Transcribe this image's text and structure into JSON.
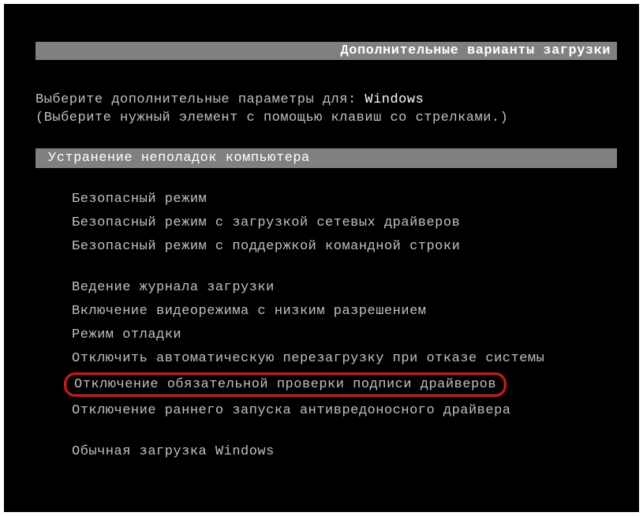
{
  "title": "Дополнительные варианты загрузки",
  "instruction_prefix": "Выберите дополнительные параметры для: ",
  "os_name": "Windows",
  "instruction_hint": "(Выберите нужный элемент с помощью клавиш со стрелками.)",
  "menu": {
    "repair": "Устранение неполадок компьютера",
    "safe_mode": "Безопасный режим",
    "safe_mode_net": "Безопасный режим с загрузкой сетевых драйверов",
    "safe_mode_cmd": "Безопасный режим с поддержкой командной строки",
    "boot_logging": "Ведение журнала загрузки",
    "low_res": "Включение видеорежима с низким разрешением",
    "debug": "Режим отладки",
    "no_auto_restart": "Отключить автоматическую перезагрузку при отказе системы",
    "disable_sig": "Отключение обязательной проверки подписи драйверов",
    "disable_elam": "Отключение раннего запуска антивредоносного драйвера",
    "normal": "Обычная загрузка Windows"
  }
}
